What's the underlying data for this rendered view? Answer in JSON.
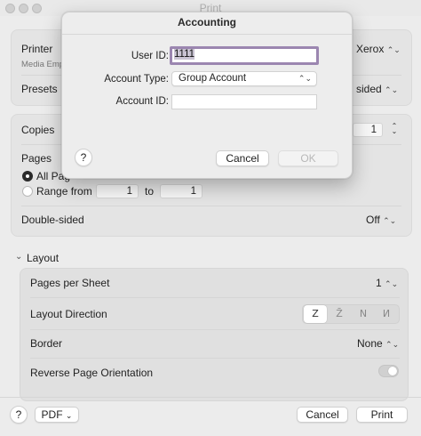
{
  "window": {
    "title": "Print"
  },
  "printer": {
    "label": "Printer",
    "value": "Xerox",
    "sublabel": "Media Emp"
  },
  "presets": {
    "label": "Presets",
    "value": "sided"
  },
  "copies": {
    "label": "Copies",
    "value": "1"
  },
  "pages": {
    "label": "Pages",
    "all_label": "All Pag",
    "range_label": "Range from",
    "from": "1",
    "to_label": "to",
    "to": "1"
  },
  "double_sided": {
    "label": "Double-sided",
    "value": "Off"
  },
  "layout": {
    "section_label": "Layout",
    "pages_per_sheet_label": "Pages per Sheet",
    "pages_per_sheet_value": "1",
    "direction_label": "Layout Direction",
    "direction_options": [
      "Z",
      "Z̄",
      "N",
      "И"
    ],
    "border_label": "Border",
    "border_value": "None",
    "reverse_label": "Reverse Page Orientation"
  },
  "footer": {
    "help": "?",
    "pdf": "PDF",
    "cancel": "Cancel",
    "print": "Print"
  },
  "dialog": {
    "title": "Accounting",
    "user_id_label": "User ID:",
    "user_id_value": "1111",
    "account_type_label": "Account Type:",
    "account_type_value": "Group Account",
    "account_id_label": "Account ID:",
    "account_id_value": "",
    "help": "?",
    "cancel": "Cancel",
    "ok": "OK"
  },
  "colors": {
    "focus_ring": "#9b86b0",
    "background": "#ececec",
    "panel": "#e4e4e4"
  }
}
